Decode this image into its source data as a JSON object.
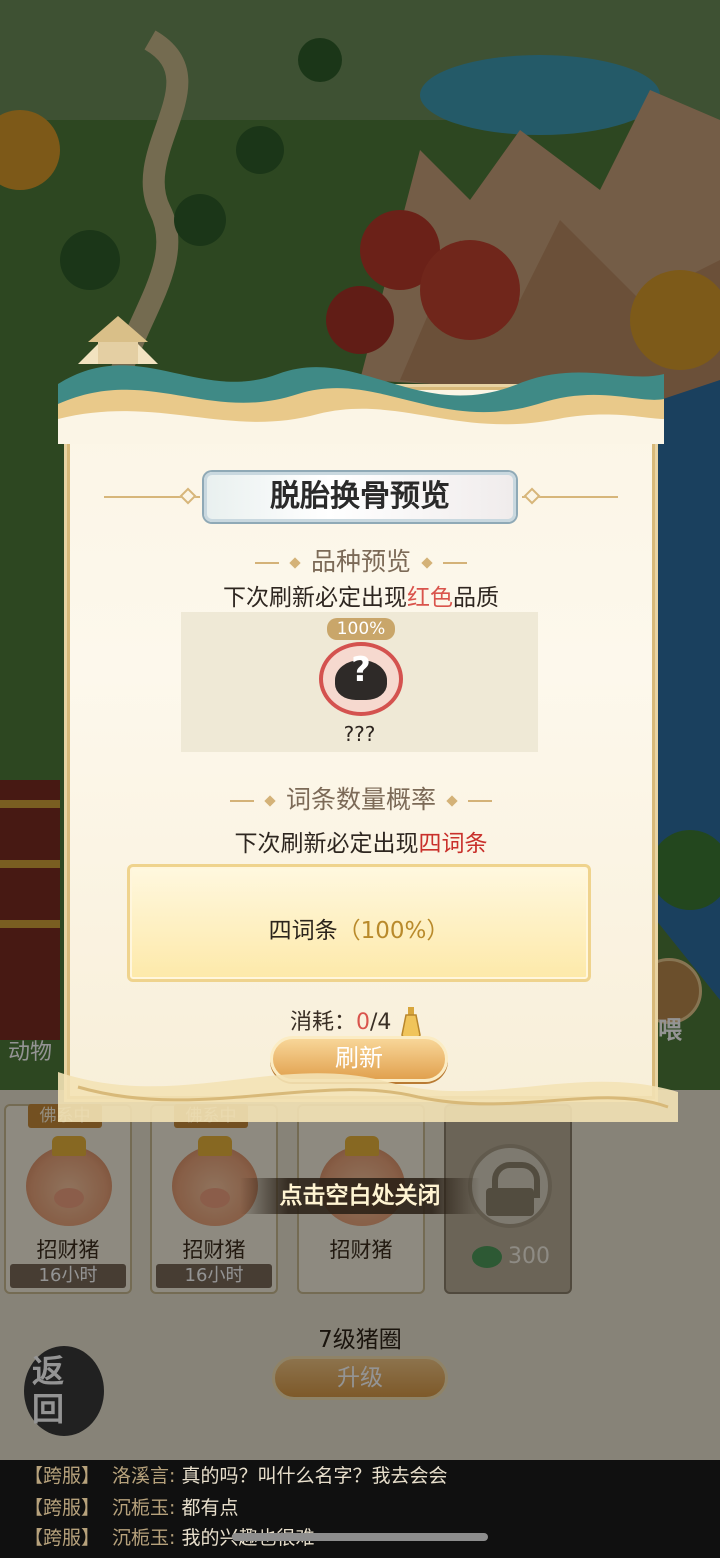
{
  "modal": {
    "title": "脱胎换骨预览",
    "breed_section": {
      "heading": "品种预览",
      "desc_prefix": "下次刷新必定出现",
      "desc_highlight": "红色",
      "desc_suffix": "品质",
      "candidate_chance": "100%",
      "candidate_glyph": "?",
      "candidate_name": "???"
    },
    "entry_section": {
      "heading": "词条数量概率",
      "desc_prefix": "下次刷新必定出现",
      "desc_highlight": "四词条",
      "entry_label": "四词条",
      "entry_chance": "（100%）"
    },
    "cost_label": "消耗：",
    "cost_current": "0",
    "cost_total": "/4",
    "refresh_label": "刷新"
  },
  "close_hint": "点击空白处关闭",
  "side_labels": {
    "animals": "动物",
    "feed": "喂"
  },
  "pen": {
    "slots": [
      {
        "badge": "佛系中",
        "name": "招财猪",
        "timer": "16小时"
      },
      {
        "badge": "佛系中",
        "name": "招财猪",
        "timer": "16小时"
      },
      {
        "badge": "",
        "name": "招财猪",
        "timer": ""
      }
    ],
    "locked_slot_cost": "300",
    "level_label": "7级猪圈",
    "upgrade_label": "升级",
    "return_label": "返回"
  },
  "chat": [
    {
      "channel": "【跨服】",
      "user": "洛溪言:",
      "message": "真的吗？叫什么名字？我去会会"
    },
    {
      "channel": "【跨服】",
      "user": "沉栀玉:",
      "message": "都有点"
    },
    {
      "channel": "【跨服】",
      "user": "沉栀玉:",
      "message": "我的兴趣也很难"
    }
  ],
  "colors": {
    "highlight_red": "#d9544c",
    "accent_gold": "#d99a48",
    "entry_pct": "#b98a2b"
  }
}
